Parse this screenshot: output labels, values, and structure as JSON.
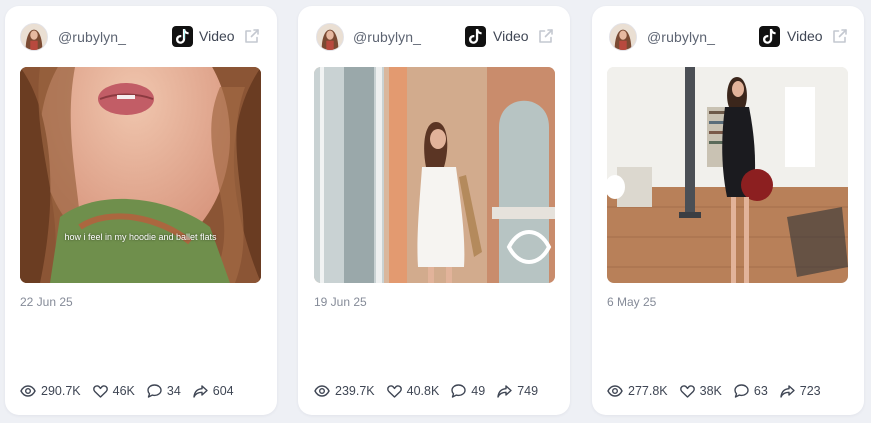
{
  "cards": [
    {
      "username": "@rubylyn_",
      "platform": "Video",
      "caption_overlay": "how i feel in my hoodie and ballet flats",
      "date": "22 Jun 25",
      "stats": {
        "views": "290.7K",
        "likes": "46K",
        "comments": "34",
        "shares": "604"
      }
    },
    {
      "username": "@rubylyn_",
      "platform": "Video",
      "caption_overlay": "",
      "date": "19 Jun 25",
      "stats": {
        "views": "239.7K",
        "likes": "40.8K",
        "comments": "49",
        "shares": "749"
      }
    },
    {
      "username": "@rubylyn_",
      "platform": "Video",
      "caption_overlay": "",
      "date": "6 May 25",
      "stats": {
        "views": "277.8K",
        "likes": "38K",
        "comments": "63",
        "shares": "723"
      }
    }
  ],
  "icons": {
    "platform": "tiktok-icon",
    "open": "external-link-icon",
    "views": "eye-icon",
    "likes": "heart-icon",
    "comments": "comment-icon",
    "shares": "share-icon"
  },
  "colors": {
    "page_background": "#eef0f5",
    "card_background": "#ffffff",
    "text_primary": "#3f4654",
    "text_muted": "#858b98",
    "icon_muted": "#c4c8d0"
  }
}
